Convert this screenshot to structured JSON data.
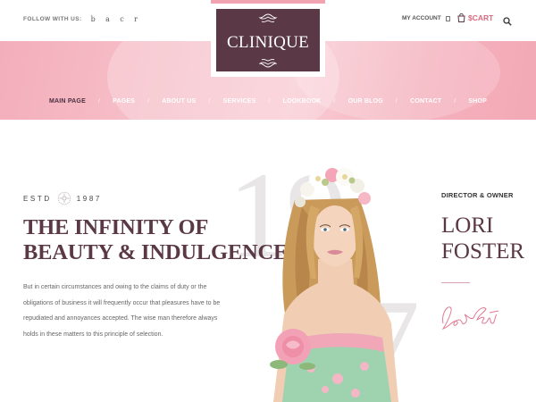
{
  "topbar": {
    "follow_label": "FOLLOW WITH US:",
    "social_icons": [
      "b",
      "a",
      "c",
      "r"
    ],
    "account_label": "MY ACCOUNT",
    "cart_label": "$CART"
  },
  "logo": {
    "text": "CLINIQUE"
  },
  "nav": {
    "items": [
      "MAIN PAGE",
      "PAGES",
      "ABOUT US",
      "SERVICES",
      "LOOKBOOK",
      "OUR BLOG",
      "CONTACT",
      "SHOP"
    ],
    "active": "MAIN PAGE"
  },
  "hero": {
    "bg_numbers": [
      "19",
      "7"
    ],
    "estd_prefix": "ESTD",
    "estd_year": "1987",
    "headline_line1": "THE INFINITY OF",
    "headline_line2": "BEAUTY & INDULGENCE",
    "paragraph": "But in certain circumstances and owing to the claims of duty or the obligations of business it will frequently occur that pleasures have to be repudiated and annoyances accepted. The wise man therefore always holds in these matters to this principle of selection."
  },
  "owner": {
    "role": "DIRECTOR & OWNER",
    "first_name": "LORI",
    "last_name": "FOSTER",
    "signature": "Lori Foster"
  },
  "colors": {
    "brand": "#5a3845",
    "pink_band": "#f6bcc6",
    "accent": "#d76a7d"
  },
  "icons": {
    "cart": "shopping-bag-icon",
    "search": "search-icon",
    "account": "user-box-icon",
    "estd": "flower-emblem-icon"
  }
}
